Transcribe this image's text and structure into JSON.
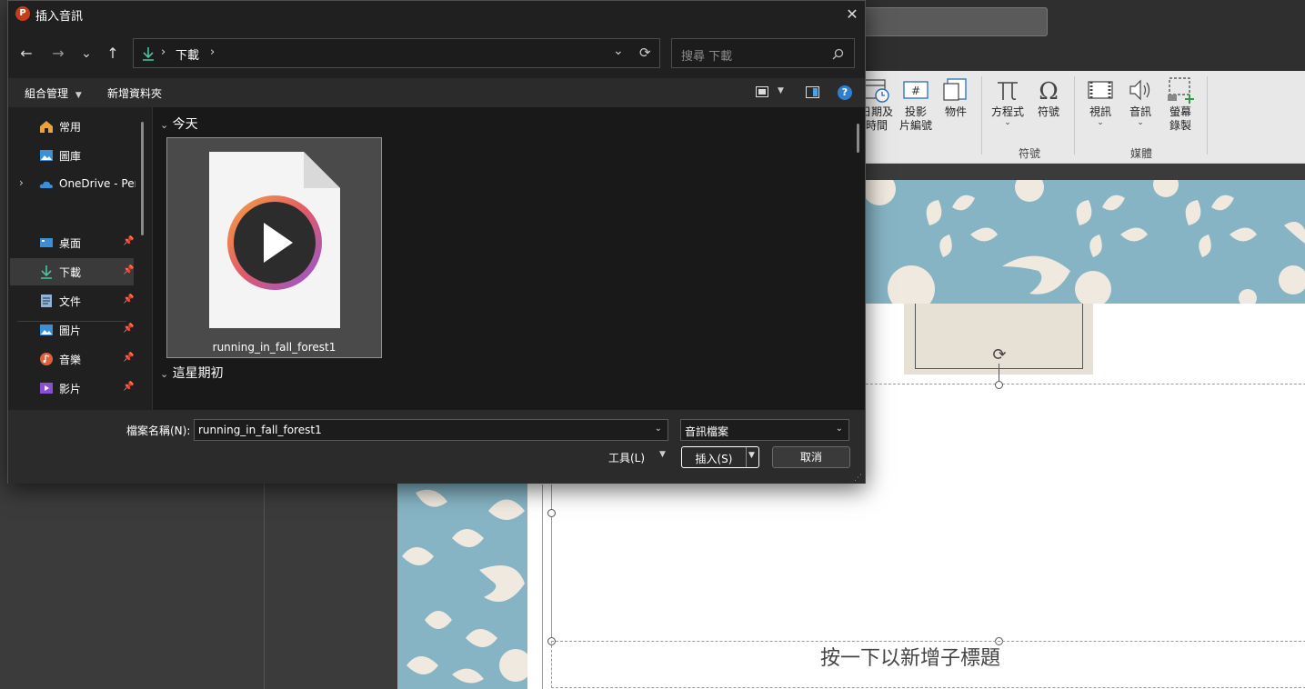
{
  "dialog": {
    "title": "插入音訊",
    "app_icon_letter": "P",
    "close_glyph": "✕",
    "nav": {
      "back": "←",
      "forward": "→",
      "recent": "⌄",
      "up": "↑"
    },
    "address": {
      "path_sep_1": "›",
      "folder": "下載",
      "path_sep_2": "›",
      "dropdown": "⌄",
      "refresh": "⟳"
    },
    "search": {
      "placeholder": "搜尋 下載",
      "icon": "search-icon"
    },
    "command_bar": {
      "organize": "組合管理",
      "new_folder": "新增資料夾"
    },
    "nav_pane": [
      {
        "label": "常用",
        "icon": "home-icon"
      },
      {
        "label": "圖庫",
        "icon": "gallery-icon"
      },
      {
        "label": "OneDrive - Pers",
        "icon": "onedrive-icon"
      },
      {
        "label": "桌面",
        "icon": "desktop-icon",
        "pinned": true
      },
      {
        "label": "下載",
        "icon": "download-icon",
        "pinned": true
      },
      {
        "label": "文件",
        "icon": "documents-icon",
        "pinned": true
      },
      {
        "label": "圖片",
        "icon": "pictures-icon",
        "pinned": true
      },
      {
        "label": "音樂",
        "icon": "music-icon",
        "pinned": true
      },
      {
        "label": "影片",
        "icon": "videos-icon",
        "pinned": true
      }
    ],
    "groups": [
      {
        "label": "今天",
        "chevron": "⌄"
      },
      {
        "label": "這星期初",
        "chevron": "⌄"
      }
    ],
    "files": [
      {
        "name": "running_in_fall_forest1",
        "icon": "media-file-icon"
      }
    ],
    "bottom": {
      "filename_label": "檔案名稱(N):",
      "filename_value": "running_in_fall_forest1",
      "filetype_value": "音訊檔案",
      "tools_label": "工具(L)",
      "insert_label": "插入(S)",
      "cancel_label": "取消"
    }
  },
  "ribbon": {
    "buttons": [
      {
        "label": "日期及\n時間",
        "icon": "datetime-icon"
      },
      {
        "label": "投影\n片編號",
        "icon": "slide-number-icon"
      },
      {
        "label": "物件",
        "icon": "object-icon"
      },
      {
        "label": "方程式",
        "icon": "equation-icon"
      },
      {
        "label": "符號",
        "icon": "symbol-icon"
      },
      {
        "label": "視訊",
        "icon": "video-icon"
      },
      {
        "label": "音訊",
        "icon": "audio-icon"
      },
      {
        "label": "螢幕\n錄製",
        "icon": "screen-recording-icon"
      }
    ],
    "groups": {
      "symbols": "符號",
      "media": "媒體"
    }
  },
  "slide": {
    "subtitle_placeholder": "按一下以新增子標題"
  },
  "colors": {
    "dialog_bg": "#202020",
    "accent_green": "#4cc2a0",
    "banner_blue": "#86b4c4",
    "banner_leaf": "#efe9df"
  }
}
